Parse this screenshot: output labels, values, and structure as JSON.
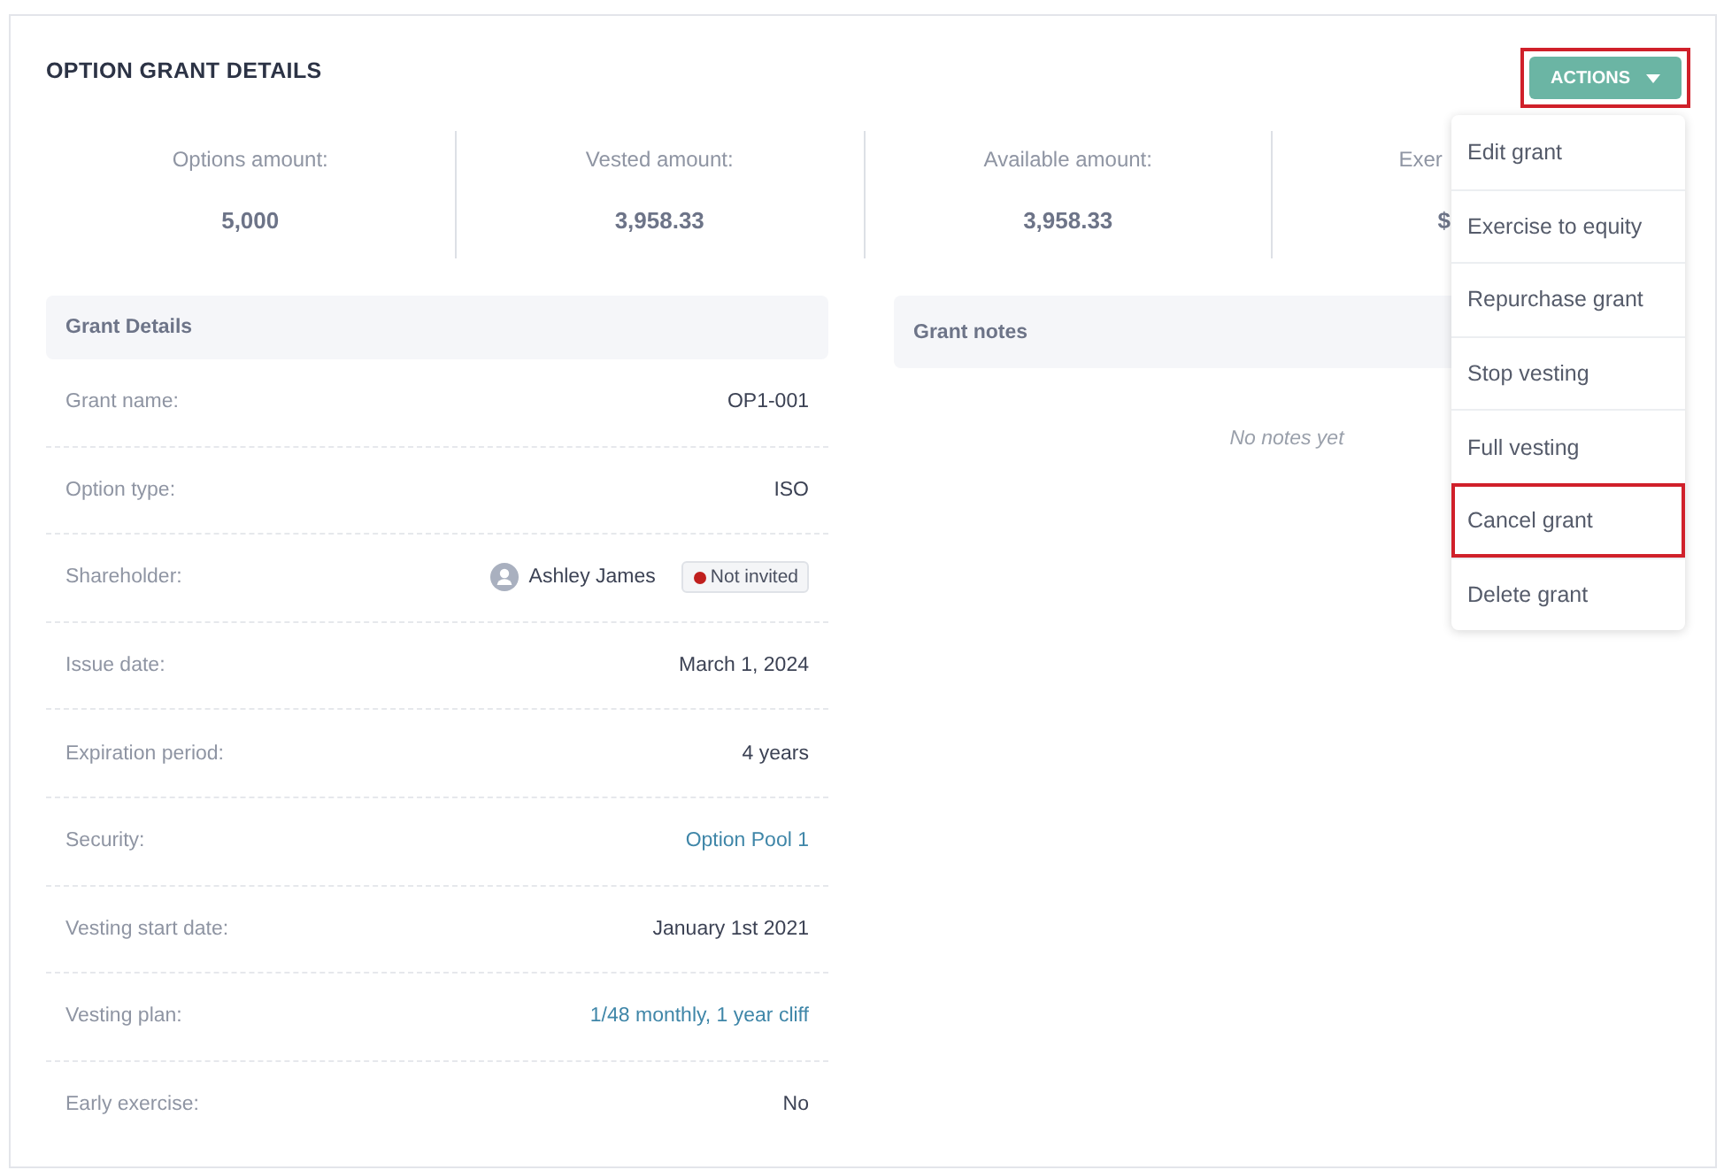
{
  "title": "OPTION GRANT DETAILS",
  "actions": {
    "label": "ACTIONS",
    "highlighted": true,
    "expanded": true
  },
  "menu": [
    {
      "label": "Edit grant",
      "highlighted": false
    },
    {
      "label": "Exercise to equity",
      "highlighted": false
    },
    {
      "label": "Repurchase grant",
      "highlighted": false
    },
    {
      "label": "Stop vesting",
      "highlighted": false
    },
    {
      "label": "Full vesting",
      "highlighted": false
    },
    {
      "label": "Cancel grant",
      "highlighted": true
    },
    {
      "label": "Delete grant",
      "highlighted": false
    }
  ],
  "stats": [
    {
      "label": "Options amount:",
      "value": "5,000"
    },
    {
      "label": "Vested amount:",
      "value": "3,958.33"
    },
    {
      "label": "Available amount:",
      "value": "3,958.33"
    },
    {
      "label": "Exer",
      "value": "$"
    }
  ],
  "grant_details": {
    "title": "Grant Details",
    "rows": [
      {
        "kind": "text",
        "label": "Grant name:",
        "value": "OP1-001"
      },
      {
        "kind": "text",
        "label": "Option type:",
        "value": "ISO"
      },
      {
        "kind": "person",
        "label": "Shareholder:",
        "value": "Ashley James",
        "badge": {
          "label": "Not invited",
          "color": "#c0201e"
        }
      },
      {
        "kind": "text",
        "label": "Issue date:",
        "value": "March 1, 2024"
      },
      {
        "kind": "text",
        "label": "Expiration period:",
        "value": "4 years"
      },
      {
        "kind": "link",
        "label": "Security:",
        "value": "Option Pool 1"
      },
      {
        "kind": "text",
        "label": "Vesting start date:",
        "value": "January 1st 2021"
      },
      {
        "kind": "link",
        "label": "Vesting plan:",
        "value": "1/48 monthly, 1 year cliff"
      },
      {
        "kind": "text",
        "label": "Early exercise:",
        "value": "No"
      }
    ]
  },
  "grant_notes": {
    "title": "Grant notes",
    "empty_text": "No notes yet"
  }
}
